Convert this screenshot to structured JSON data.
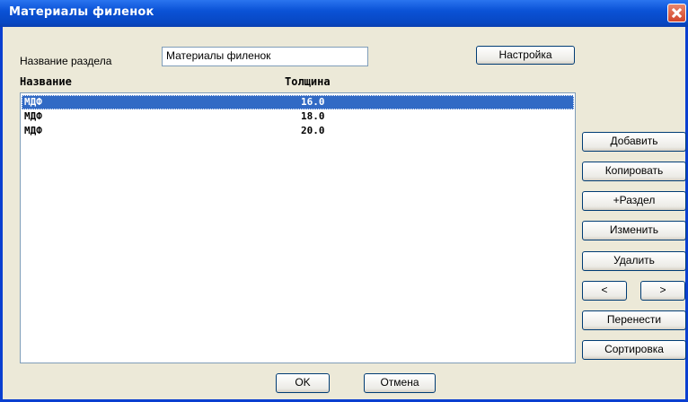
{
  "window": {
    "title": "Материалы филенок"
  },
  "section": {
    "label": "Название раздела",
    "value": "Материалы филенок"
  },
  "settings_label": "Настройка",
  "table": {
    "headers": [
      "Название",
      "Толщина"
    ],
    "rows": [
      {
        "name": "МДФ",
        "thickness": "16.0",
        "selected": true
      },
      {
        "name": "МДФ",
        "thickness": "18.0",
        "selected": false
      },
      {
        "name": "МДФ",
        "thickness": "20.0",
        "selected": false
      }
    ]
  },
  "side_buttons": {
    "add": "Добавить",
    "copy": "Копировать",
    "add_section": "+Раздел",
    "edit": "Изменить",
    "delete": "Удалить",
    "left": "<",
    "right": ">",
    "move": "Перенести",
    "sort": "Сортировка"
  },
  "footer": {
    "ok": "OK",
    "cancel": "Отмена"
  },
  "colors": {
    "title_bar": "#0a52d6",
    "selection": "#316ac5",
    "dialog_bg": "#ece9d8"
  }
}
